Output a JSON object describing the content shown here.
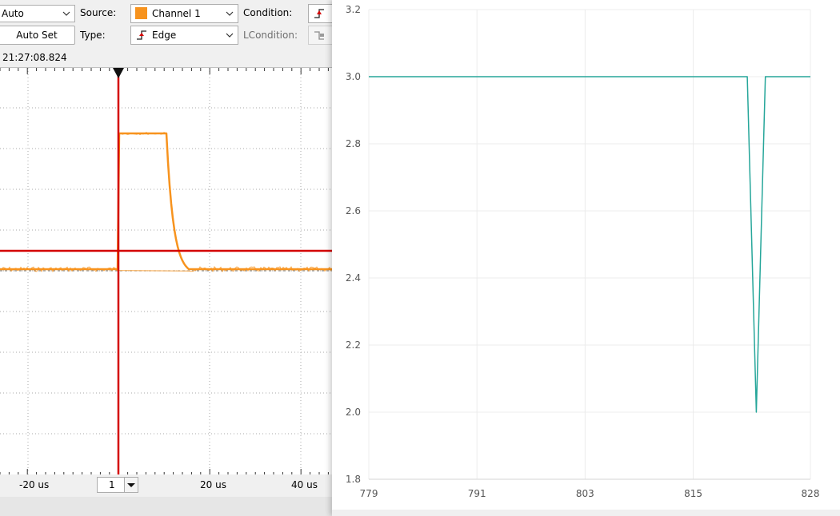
{
  "trigger": {
    "mode_value": "Auto",
    "auto_set_label": "Auto Set",
    "source_label": "Source:",
    "source_value": "Channel 1",
    "source_color": "#f7931e",
    "type_label": "Type:",
    "type_value": "Edge",
    "condition_label": "Condition:",
    "lcondition_label": "LCondition:"
  },
  "scope": {
    "timestamp": "21:27:08.824",
    "x_tick_labels": [
      "-20 us",
      "20 us",
      "40 us"
    ],
    "channel_select_value": "1",
    "trace_color": "#f7931e",
    "cursor_color": "#d40000"
  },
  "icons": [
    "chevron-down-icon",
    "rising-edge-icon",
    "edge-trigger-icon",
    "level-trigger-icon",
    "trigger-marker-icon"
  ],
  "chart_data": {
    "type": "line",
    "title": "",
    "xlabel": "",
    "ylabel": "",
    "xlim": [
      779,
      828
    ],
    "ylim": [
      1.8,
      3.2
    ],
    "x_ticks": [
      779,
      791,
      803,
      815,
      828
    ],
    "y_ticks": [
      1.8,
      2.0,
      2.2,
      2.4,
      2.6,
      2.8,
      3.0,
      3.2
    ],
    "grid": true,
    "line_color": "#26a69a",
    "series": [
      {
        "x": [
          779,
          821,
          822,
          823,
          828
        ],
        "values": [
          3.0,
          3.0,
          2.0,
          3.0,
          3.0
        ]
      }
    ]
  }
}
